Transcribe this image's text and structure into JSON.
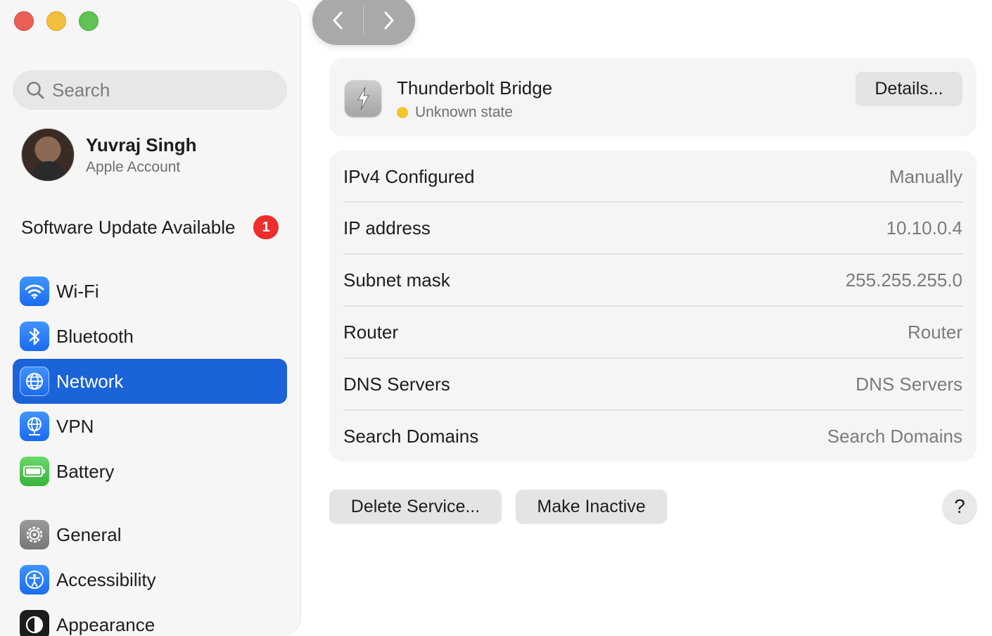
{
  "sidebar": {
    "search": {
      "placeholder": "Search"
    },
    "account": {
      "name": "Yuvraj Singh",
      "subtitle": "Apple Account"
    },
    "update": {
      "label": "Software Update Available",
      "badge": "1"
    },
    "items": [
      {
        "label": "Wi-Fi",
        "icon": "wifi-icon"
      },
      {
        "label": "Bluetooth",
        "icon": "bluetooth-icon"
      },
      {
        "label": "Network",
        "icon": "globe-icon",
        "selected": true
      },
      {
        "label": "VPN",
        "icon": "vpn-globe-icon"
      },
      {
        "label": "Battery",
        "icon": "battery-icon"
      },
      {
        "label": "General",
        "icon": "gear-icon"
      },
      {
        "label": "Accessibility",
        "icon": "accessibility-icon"
      },
      {
        "label": "Appearance",
        "icon": "appearance-icon"
      }
    ]
  },
  "toolbar": {
    "back_icon": "chevron-left-icon",
    "forward_icon": "chevron-right-icon"
  },
  "service": {
    "name": "Thunderbolt Bridge",
    "status": "Unknown state",
    "status_color": "#f3c42c",
    "details_label": "Details..."
  },
  "info": {
    "rows": [
      {
        "label": "IPv4 Configured",
        "value": "Manually"
      },
      {
        "label": "IP address",
        "value": "10.10.0.4"
      },
      {
        "label": "Subnet mask",
        "value": "255.255.255.0"
      },
      {
        "label": "Router",
        "value": "Router"
      },
      {
        "label": "DNS Servers",
        "value": "DNS Servers"
      },
      {
        "label": "Search Domains",
        "value": "Search Domains"
      }
    ]
  },
  "actions": {
    "delete_label": "Delete Service...",
    "inactive_label": "Make Inactive",
    "help_label": "?"
  },
  "colors": {
    "accent": "#1a63d8",
    "badge": "#ee2d2d"
  }
}
